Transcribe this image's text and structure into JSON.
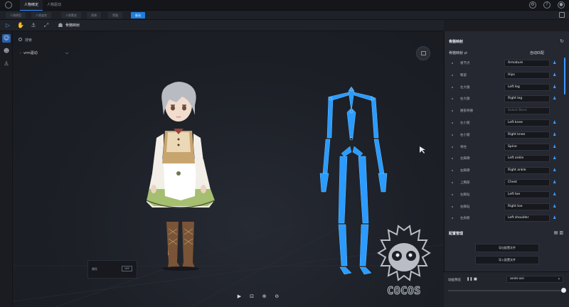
{
  "titlebar": {
    "tabs": [
      {
        "label": "人物绑定",
        "active": true
      },
      {
        "label": "人物驱动",
        "active": false
      }
    ]
  },
  "subtabs": [
    {
      "label": "人物模型",
      "active": false
    },
    {
      "label": "人物姿势",
      "active": false
    },
    {
      "label": "人物蒙皮",
      "active": false
    },
    {
      "label": "表情",
      "active": false
    },
    {
      "label": "骨骼",
      "active": false
    },
    {
      "label": "驱动",
      "active": true
    }
  ],
  "toolbar": {
    "tool_label": "骨骼映射"
  },
  "viewport": {
    "search_placeholder": "搜索",
    "tree_item": "vrm驱动",
    "props_label": "属性",
    "props_tag": "OFF"
  },
  "panel": {
    "title": "骨骼映射",
    "mapping_label": "骨骼映射",
    "mapping_right": "自动匹配",
    "rows": [
      {
        "label": "根节点",
        "value": "Armature",
        "placeholder": false,
        "mapped": true
      },
      {
        "label": "臀部",
        "value": "Hips",
        "placeholder": false,
        "mapped": true
      },
      {
        "label": "左大腿",
        "value": "Left leg",
        "placeholder": false,
        "mapped": true
      },
      {
        "label": "右大腿",
        "value": "Right leg",
        "placeholder": false,
        "mapped": true
      },
      {
        "label": "腰部骨骼",
        "value": "Select Bone",
        "placeholder": true,
        "mapped": false
      },
      {
        "label": "左小腿",
        "value": "Left knee",
        "placeholder": false,
        "mapped": true
      },
      {
        "label": "右小腿",
        "value": "Right knee",
        "placeholder": false,
        "mapped": true
      },
      {
        "label": "脊柱",
        "value": "Spine",
        "placeholder": false,
        "mapped": true
      },
      {
        "label": "左脚踝",
        "value": "Left ankle",
        "placeholder": false,
        "mapped": true
      },
      {
        "label": "右脚踝",
        "value": "Right ankle",
        "placeholder": false,
        "mapped": true
      },
      {
        "label": "上胸部",
        "value": "Chest",
        "placeholder": false,
        "mapped": true
      },
      {
        "label": "左脚趾",
        "value": "Left toe",
        "placeholder": false,
        "mapped": true
      },
      {
        "label": "右脚趾",
        "value": "Right toe",
        "placeholder": false,
        "mapped": true
      },
      {
        "label": "左肩膀",
        "value": "Left shoulder",
        "placeholder": false,
        "mapped": true
      }
    ],
    "section2_title": "配置管理",
    "btn1": "导出配置文件",
    "btn2": "导入配置文件"
  },
  "anim": {
    "label": "动画预览",
    "select_value": "anim-ani"
  },
  "cocos": {
    "text": "COCOS"
  },
  "colors": {
    "accent": "#1f7fe0",
    "skeleton": "#2b9bff",
    "panel_bg": "#252830",
    "viewport_bg": "#1c1f26"
  }
}
